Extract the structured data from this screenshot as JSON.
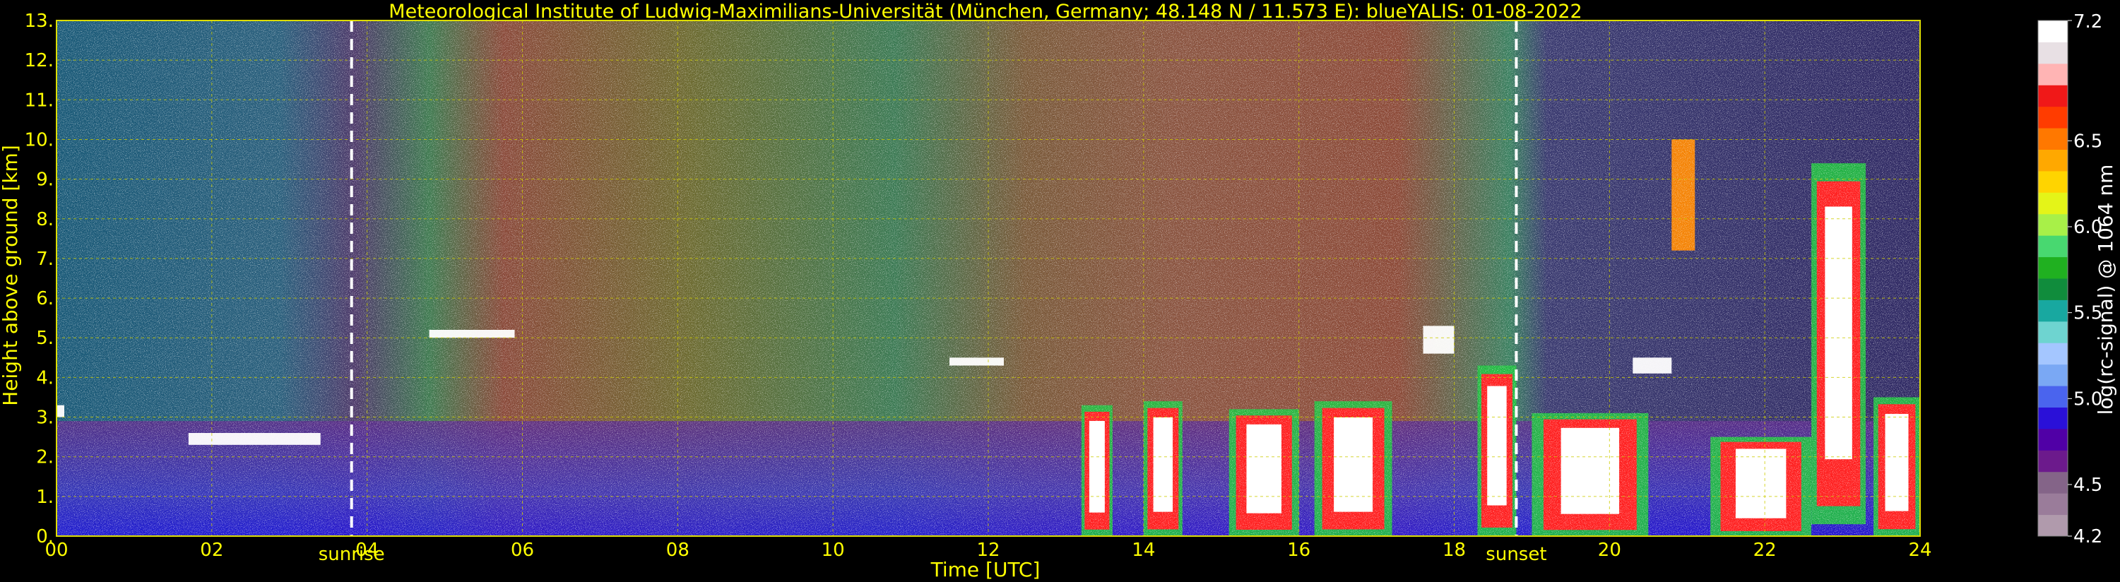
{
  "chart_data": {
    "type": "heatmap",
    "title": "Meteorological Institute of Ludwig-Maximilians-Universität (München, Germany; 48.148 N / 11.573 E):    blueYALIS: 01-08-2022",
    "xlabel": "Time [UTC]",
    "ylabel": "Height above ground [km]",
    "xlim": [
      0,
      24
    ],
    "ylim": [
      0,
      13
    ],
    "x_ticks": [
      {
        "value": 0,
        "label": "00"
      },
      {
        "value": 2,
        "label": "02"
      },
      {
        "value": 4,
        "label": "04"
      },
      {
        "value": 6,
        "label": "06"
      },
      {
        "value": 8,
        "label": "08"
      },
      {
        "value": 10,
        "label": "10"
      },
      {
        "value": 12,
        "label": "12"
      },
      {
        "value": 14,
        "label": "14"
      },
      {
        "value": 16,
        "label": "16"
      },
      {
        "value": 18,
        "label": "18"
      },
      {
        "value": 20,
        "label": "20"
      },
      {
        "value": 22,
        "label": "22"
      },
      {
        "value": 24,
        "label": "24"
      }
    ],
    "y_ticks": [
      {
        "value": 0,
        "label": "0."
      },
      {
        "value": 1,
        "label": "1."
      },
      {
        "value": 2,
        "label": "2."
      },
      {
        "value": 3,
        "label": "3."
      },
      {
        "value": 4,
        "label": "4."
      },
      {
        "value": 5,
        "label": "5."
      },
      {
        "value": 6,
        "label": "6."
      },
      {
        "value": 7,
        "label": "7."
      },
      {
        "value": 8,
        "label": "8."
      },
      {
        "value": 9,
        "label": "9."
      },
      {
        "value": 10,
        "label": "10."
      },
      {
        "value": 11,
        "label": "11."
      },
      {
        "value": 12,
        "label": "12."
      },
      {
        "value": 13,
        "label": "13."
      }
    ],
    "grid": true,
    "annotations": [
      {
        "time": 3.8,
        "label": "sunrise",
        "line": "dashed-white"
      },
      {
        "time": 18.8,
        "label": "sunset",
        "line": "dashed-white"
      }
    ],
    "colorbar": {
      "label": "log(rc-signal) @ 1064 nm",
      "range": [
        4.2,
        7.2
      ],
      "ticks": [
        {
          "value": 4.2,
          "label": "4.2"
        },
        {
          "value": 4.5,
          "label": "4.5"
        },
        {
          "value": 5.0,
          "label": "5.0"
        },
        {
          "value": 5.5,
          "label": "5.5"
        },
        {
          "value": 6.0,
          "label": "6.0"
        },
        {
          "value": 6.5,
          "label": "6.5"
        },
        {
          "value": 7.2,
          "label": "7.2"
        }
      ],
      "colors": [
        "#b09aac",
        "#9a7c9a",
        "#846488",
        "#6c1a8c",
        "#5000a6",
        "#2a10d8",
        "#4a64ee",
        "#7aa8f4",
        "#a4c6ff",
        "#6ed4d0",
        "#18a8a0",
        "#108c3c",
        "#20b020",
        "#48d870",
        "#a8f048",
        "#e4f418",
        "#ffd400",
        "#ffa800",
        "#ff7800",
        "#ff3c00",
        "#f01818",
        "#ffb4b4",
        "#e8e0e4",
        "#ffffff"
      ]
    },
    "features": [
      {
        "name": "boundary-layer aerosol",
        "x": [
          0,
          24
        ],
        "y": [
          0,
          2.9
        ]
      },
      {
        "name": "cloud layer",
        "x": [
          0.0,
          0.1
        ],
        "y": [
          3.0,
          3.3
        ]
      },
      {
        "name": "cloud layer",
        "x": [
          1.7,
          3.4
        ],
        "y": [
          2.3,
          2.6
        ]
      },
      {
        "name": "cloud layer",
        "x": [
          4.8,
          5.9
        ],
        "y": [
          5.0,
          5.2
        ]
      },
      {
        "name": "cloud layer",
        "x": [
          11.5,
          12.2
        ],
        "y": [
          4.3,
          4.5
        ]
      },
      {
        "name": "convective cloud",
        "x": [
          13.2,
          13.6
        ],
        "y": [
          0,
          3.3
        ]
      },
      {
        "name": "convective cloud",
        "x": [
          14.0,
          14.5
        ],
        "y": [
          0,
          3.4
        ]
      },
      {
        "name": "convective cloud",
        "x": [
          15.1,
          16.0
        ],
        "y": [
          0,
          3.2
        ]
      },
      {
        "name": "convective cloud",
        "x": [
          16.2,
          17.2
        ],
        "y": [
          0,
          3.4
        ]
      },
      {
        "name": "cloud layer",
        "x": [
          17.6,
          18.0
        ],
        "y": [
          4.6,
          5.3
        ]
      },
      {
        "name": "convective cloud",
        "x": [
          18.3,
          18.8
        ],
        "y": [
          0,
          4.3
        ]
      },
      {
        "name": "convective cloud",
        "x": [
          19.0,
          20.5
        ],
        "y": [
          0,
          3.1
        ]
      },
      {
        "name": "cloud layer",
        "x": [
          20.3,
          20.8
        ],
        "y": [
          4.1,
          4.5
        ]
      },
      {
        "name": "convective cloud",
        "x": [
          21.3,
          22.6
        ],
        "y": [
          0,
          2.5
        ]
      },
      {
        "name": "convective cloud",
        "x": [
          22.6,
          23.3
        ],
        "y": [
          0.3,
          9.4
        ]
      },
      {
        "name": "convective cloud",
        "x": [
          23.4,
          24.0
        ],
        "y": [
          0,
          3.5
        ]
      },
      {
        "name": "cirrus",
        "x": [
          20.8,
          21.1
        ],
        "y": [
          7.2,
          10.0
        ]
      }
    ]
  }
}
